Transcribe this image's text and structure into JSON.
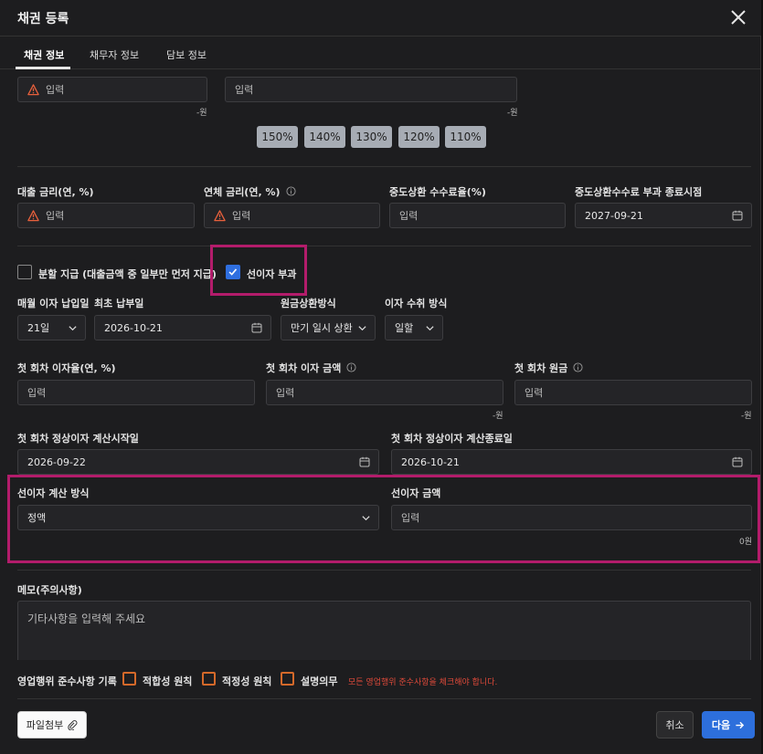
{
  "header": {
    "title": "채권 등록"
  },
  "tabs": [
    {
      "label": "채권 정보"
    },
    {
      "label": "채무자 정보"
    },
    {
      "label": "담보 정보"
    }
  ],
  "top_row": {
    "input1_placeholder": "입력",
    "input1_unit": "-원",
    "input2_placeholder": "입력",
    "input2_unit": "-원"
  },
  "ratio_pills": [
    "150%",
    "140%",
    "130%",
    "120%",
    "110%"
  ],
  "rates": {
    "loan_rate_label": "대출 금리(연, %)",
    "overdue_rate_label": "연체 금리(연, %)",
    "prepay_fee_label": "중도상환 수수료율(%)",
    "prepay_end_label": "중도상환수수료 부과 종료시점",
    "loan_rate_placeholder": "입력",
    "overdue_rate_placeholder": "입력",
    "prepay_fee_placeholder": "입력",
    "prepay_end_value": "2027-09-21"
  },
  "options": {
    "split_label": "분할 지급 (대출금액 중 일부만 먼저 지급)",
    "split_checked": false,
    "prepaid_interest_label": "선이자 부과",
    "prepaid_interest_checked": true
  },
  "schedule": {
    "monthly_day_label": "매월 이자 납입일",
    "monthly_day_value": "21일",
    "first_pay_label": "최초 납부일",
    "first_pay_value": "2026-10-21",
    "repay_method_label": "원금상환방식",
    "repay_method_value": "만기 일시 상환",
    "interest_collect_label": "이자 수취 방식",
    "interest_collect_value": "일할"
  },
  "first_period": {
    "rate_label": "첫 회차 이자율(연, %)",
    "rate_placeholder": "입력",
    "interest_label": "첫 회차 이자 금액",
    "interest_placeholder": "입력",
    "interest_unit": "-원",
    "principal_label": "첫 회차 원금",
    "principal_placeholder": "입력",
    "principal_unit": "-원",
    "calc_start_label": "첫 회차 정상이자 계산시작일",
    "calc_start_value": "2026-09-22",
    "calc_end_label": "첫 회차 정상이자 계산종료일",
    "calc_end_value": "2026-10-21"
  },
  "prepaid": {
    "method_label": "선이자 계산 방식",
    "method_value": "정액",
    "amount_label": "선이자 금액",
    "amount_placeholder": "입력",
    "amount_unit": "0원"
  },
  "memo": {
    "label": "메모(주의사항)",
    "placeholder": "기타사항을 입력해 주세요"
  },
  "compliance": {
    "label": "영업행위 준수사항 기록",
    "items": [
      "적합성 원칙",
      "적정성 원칙",
      "설명의무"
    ],
    "warning": "모든 영업행위 준수사항을 체크해야 합니다."
  },
  "footer": {
    "attach_label": "파일첨부",
    "cancel_label": "취소",
    "next_label": "다음"
  },
  "colors": {
    "accent": "#2d6fdc",
    "highlight": "#b31c6b",
    "warning": "#e04a3a",
    "checkbox_orange": "#d4692a"
  }
}
